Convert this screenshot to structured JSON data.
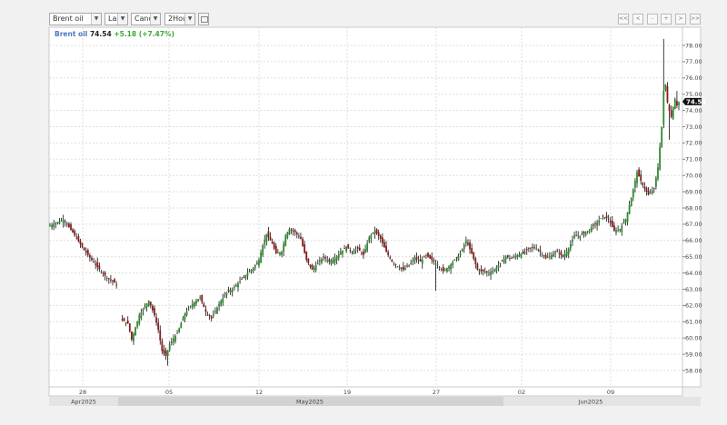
{
  "toolbar": {
    "symbol_value": "Brent oil",
    "price_type": "Last",
    "chart_style": "Candle",
    "interval": "2Hour",
    "nav_buttons": [
      "<<",
      "<",
      "-",
      "+",
      ">",
      ">>"
    ]
  },
  "legend": {
    "name": "Brent oil",
    "last": "74.54",
    "change": "+5.18 (+7.47%)"
  },
  "colors": {
    "up": "#2e8b2e",
    "down": "#8b1a1a",
    "wick": "#111111",
    "grid": "#dddddd",
    "last_label_bg": "#111111",
    "legend_name": "#4a78c2",
    "legend_change": "#3aaa35"
  },
  "chart_data": {
    "type": "candlestick",
    "title": "Brent oil",
    "ylim": [
      58.0,
      78.0
    ],
    "y_ticks": [
      "58.00",
      "59.00",
      "60.00",
      "61.00",
      "62.00",
      "63.00",
      "64.00",
      "65.00",
      "66.00",
      "67.00",
      "68.00",
      "69.00",
      "70.00",
      "71.00",
      "72.00",
      "73.00",
      "74.00",
      "75.00",
      "76.00",
      "77.00",
      "78.00"
    ],
    "y_tick_values": [
      58,
      59,
      60,
      61,
      62,
      63,
      64,
      65,
      66,
      67,
      68,
      69,
      70,
      71,
      72,
      73,
      74,
      75,
      76,
      77,
      78
    ],
    "x_ticks": [
      "28",
      "05",
      "12",
      "19",
      "27",
      "02",
      "09"
    ],
    "months": [
      "Apr2025",
      "May2025",
      "Jun2025"
    ],
    "last_value": "74.54",
    "grid": true,
    "anchors": [
      [
        0,
        66.9
      ],
      [
        7,
        67.3
      ],
      [
        12,
        66.5
      ],
      [
        18,
        65.4
      ],
      [
        24,
        64.5
      ],
      [
        30,
        63.7
      ],
      [
        34,
        63.4
      ],
      [
        36,
        63.1
      ],
      [
        37,
        null
      ],
      [
        38,
        61.1
      ],
      [
        41,
        60.9
      ],
      [
        43,
        59.9
      ],
      [
        47,
        61.4
      ],
      [
        52,
        62.3
      ],
      [
        55,
        61.4
      ],
      [
        57,
        60.5
      ],
      [
        59,
        59.2
      ],
      [
        61,
        58.9
      ],
      [
        63,
        59.6
      ],
      [
        67,
        60.3
      ],
      [
        71,
        61.5
      ],
      [
        75,
        62.1
      ],
      [
        79,
        62.5
      ],
      [
        82,
        61.6
      ],
      [
        85,
        61.2
      ],
      [
        89,
        62.1
      ],
      [
        93,
        62.8
      ],
      [
        96,
        63.0
      ],
      [
        100,
        63.5
      ],
      [
        104,
        64.0
      ],
      [
        107,
        64.3
      ],
      [
        110,
        64.8
      ],
      [
        112,
        65.7
      ],
      [
        114,
        66.4
      ],
      [
        117,
        65.8
      ],
      [
        119,
        65.2
      ],
      [
        122,
        65.3
      ],
      [
        124,
        66.3
      ],
      [
        126,
        66.7
      ],
      [
        129,
        66.5
      ],
      [
        132,
        66.1
      ],
      [
        135,
        64.8
      ],
      [
        138,
        64.2
      ],
      [
        141,
        64.6
      ],
      [
        144,
        65.0
      ],
      [
        147,
        64.7
      ],
      [
        150,
        64.9
      ],
      [
        153,
        65.3
      ],
      [
        156,
        65.6
      ],
      [
        159,
        65.3
      ],
      [
        162,
        65.5
      ],
      [
        165,
        65.1
      ],
      [
        168,
        66.2
      ],
      [
        171,
        66.6
      ],
      [
        174,
        66.1
      ],
      [
        177,
        65.3
      ],
      [
        180,
        64.7
      ],
      [
        183,
        64.4
      ],
      [
        186,
        64.2
      ],
      [
        189,
        64.5
      ],
      [
        192,
        64.9
      ],
      [
        195,
        64.7
      ],
      [
        198,
        65.1
      ],
      [
        201,
        64.8
      ],
      [
        204,
        64.5
      ],
      [
        207,
        64.1
      ],
      [
        210,
        64.4
      ],
      [
        213,
        64.8
      ],
      [
        216,
        65.2
      ],
      [
        219,
        66.0
      ],
      [
        222,
        65.2
      ],
      [
        225,
        64.2
      ],
      [
        228,
        64.1
      ],
      [
        231,
        64.0
      ],
      [
        234,
        64.2
      ],
      [
        237,
        64.6
      ],
      [
        240,
        65.0
      ],
      [
        243,
        64.9
      ],
      [
        246,
        65.1
      ],
      [
        249,
        65.2
      ],
      [
        252,
        65.5
      ],
      [
        255,
        65.6
      ],
      [
        258,
        65.3
      ],
      [
        261,
        64.9
      ],
      [
        264,
        65.1
      ],
      [
        267,
        65.3
      ],
      [
        270,
        65.0
      ],
      [
        273,
        65.5
      ],
      [
        276,
        66.3
      ],
      [
        279,
        66.3
      ],
      [
        282,
        66.5
      ],
      [
        285,
        66.8
      ],
      [
        288,
        67.1
      ],
      [
        291,
        67.5
      ],
      [
        294,
        67.3
      ],
      [
        297,
        66.6
      ],
      [
        300,
        66.7
      ],
      [
        303,
        67.3
      ],
      [
        306,
        68.6
      ],
      [
        309,
        70.2
      ],
      [
        312,
        69.4
      ],
      [
        315,
        68.8
      ],
      [
        318,
        69.2
      ],
      [
        320,
        70.5
      ],
      [
        322,
        73.0
      ],
      [
        323,
        75.2
      ],
      [
        324,
        75.6
      ],
      [
        325,
        74.5
      ],
      [
        326,
        74.0
      ],
      [
        327,
        73.6
      ],
      [
        328,
        74.2
      ],
      [
        329,
        74.7
      ],
      [
        330,
        74.3
      ],
      [
        331,
        74.5
      ]
    ],
    "spikes": [
      [
        323,
        78.4
      ],
      [
        326,
        72.2
      ],
      [
        62,
        58.3
      ],
      [
        203,
        62.9
      ],
      [
        330,
        75.2
      ]
    ]
  }
}
